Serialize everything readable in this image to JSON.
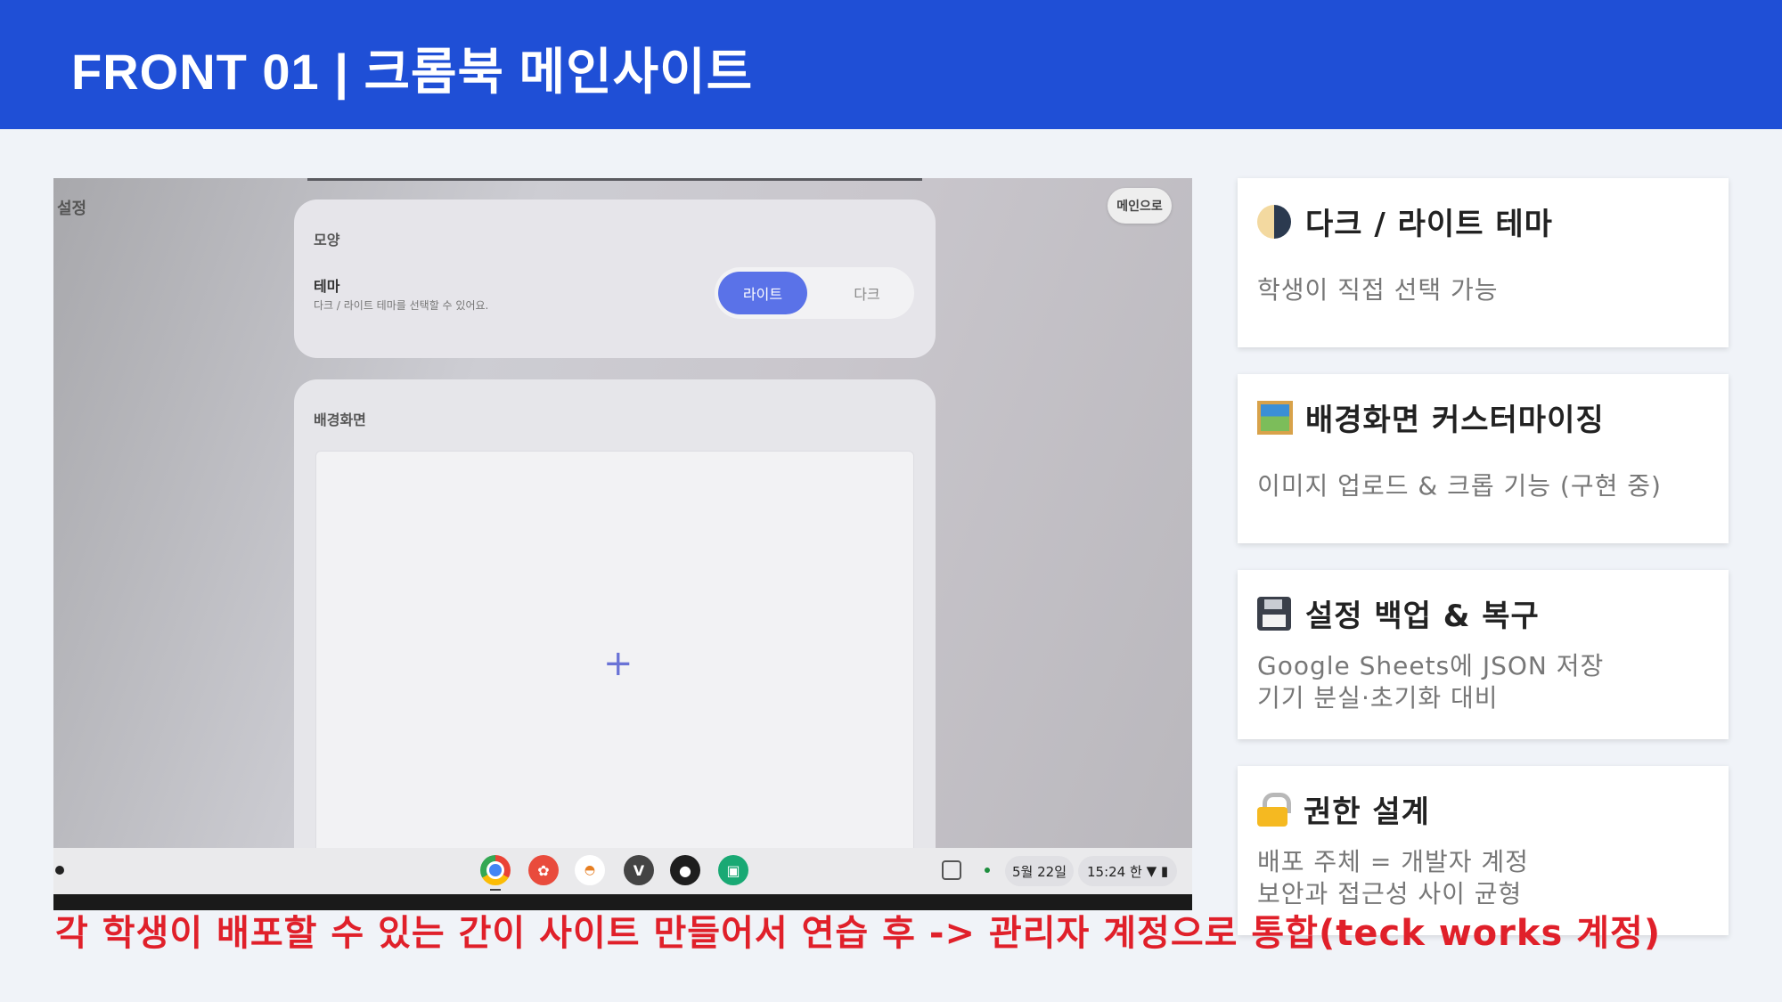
{
  "header": {
    "title": "FRONT 01  |  크롬북 메인사이트"
  },
  "screenshot": {
    "settings_label": "설정",
    "main_button": "메인으로",
    "appearance": {
      "section": "모양",
      "theme_label": "테마",
      "theme_desc": "다크 / 라이트 테마를 선택할 수 있어요.",
      "light_option": "라이트",
      "dark_option": "다크",
      "selected": "라이트"
    },
    "background": {
      "label": "배경화면",
      "add_symbol": "+"
    },
    "shelf": {
      "apps": [
        "chrome-icon",
        "app-red-icon",
        "rainbow-icon",
        "v-icon",
        "figma-icon",
        "classroom-icon"
      ],
      "v_letter": "V",
      "date": "5월 22일",
      "time": "15:24 한"
    }
  },
  "features": [
    {
      "icon": "half-moon-icon",
      "title": "다크 / 라이트 테마",
      "lines": [
        "학생이 직접 선택 가능"
      ]
    },
    {
      "icon": "framed-picture-icon",
      "title": "배경화면 커스터마이징",
      "lines": [
        "이미지 업로드 & 크롭 기능 (구현 중)"
      ]
    },
    {
      "icon": "floppy-disk-icon",
      "title": "설정 백업 & 복구",
      "lines": [
        "Google Sheets에 JSON 저장",
        "기기 분실·초기화 대비"
      ]
    },
    {
      "icon": "lock-icon",
      "title": "권한 설계",
      "lines": [
        "배포 주체 = 개발자 계정",
        "보안과 접근성 사이 균형"
      ]
    }
  ],
  "caption": "각 학생이 배포할 수 있는 간이 사이트 만들어서 연습 후 -> 관리자 계정으로 통합(teck works 계정)",
  "colors": {
    "header": "#1f4fd6",
    "caption": "#e0202a",
    "toggle_active": "#5a72e8"
  }
}
